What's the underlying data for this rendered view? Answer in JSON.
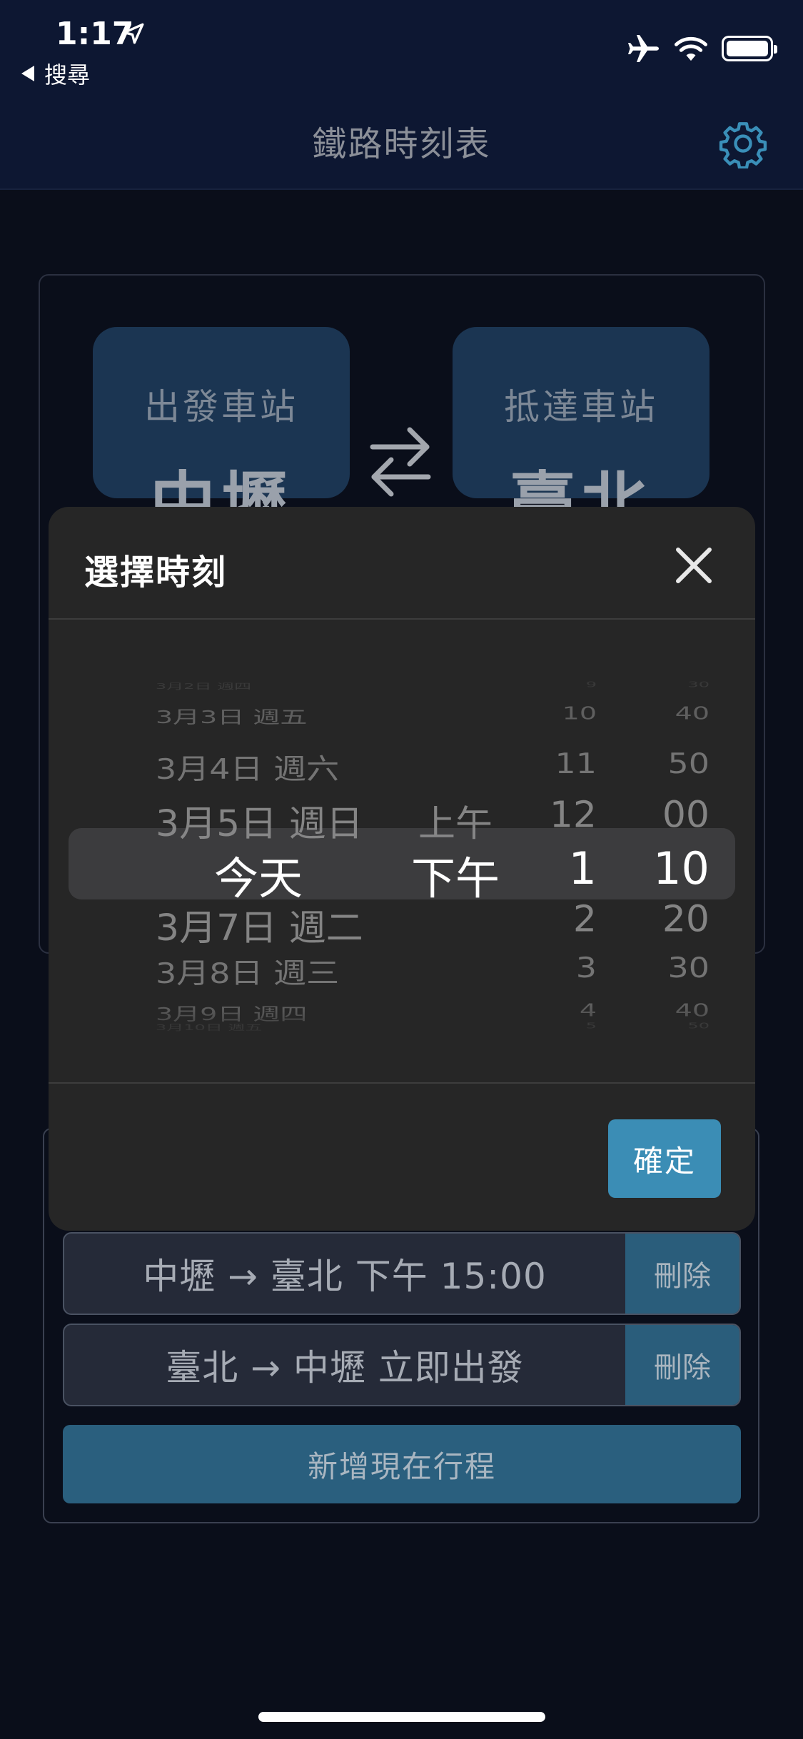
{
  "status_bar": {
    "time": "1:17",
    "back_label": "搜尋"
  },
  "header": {
    "title": "鐵路時刻表"
  },
  "stations": {
    "departure_label": "出發車站",
    "departure_name": "中壢",
    "arrival_label": "抵達車站",
    "arrival_name": "臺北"
  },
  "modal": {
    "title": "選擇時刻",
    "confirm_label": "確定",
    "picker_rows": [
      {
        "date": "3月2日 週四",
        "ampm": "",
        "hour": "9",
        "minute": "30"
      },
      {
        "date": "3月3日 週五",
        "ampm": "",
        "hour": "10",
        "minute": "40"
      },
      {
        "date": "3月4日 週六",
        "ampm": "",
        "hour": "11",
        "minute": "50"
      },
      {
        "date": "3月5日 週日",
        "ampm": "上午",
        "hour": "12",
        "minute": "00"
      },
      {
        "date": "今天",
        "ampm": "下午",
        "hour": "1",
        "minute": "10"
      },
      {
        "date": "3月7日 週二",
        "ampm": "",
        "hour": "2",
        "minute": "20"
      },
      {
        "date": "3月8日 週三",
        "ampm": "",
        "hour": "3",
        "minute": "30"
      },
      {
        "date": "3月9日 週四",
        "ampm": "",
        "hour": "4",
        "minute": "40"
      },
      {
        "date": "3月10日 週五",
        "ampm": "",
        "hour": "5",
        "minute": "50"
      }
    ]
  },
  "trips": [
    {
      "text": "中壢 → 臺北 下午 15:00",
      "delete_label": "刪除"
    },
    {
      "text": "臺北 → 中壢 立即出發",
      "delete_label": "刪除"
    }
  ],
  "add_trip_label": "新增現在行程"
}
